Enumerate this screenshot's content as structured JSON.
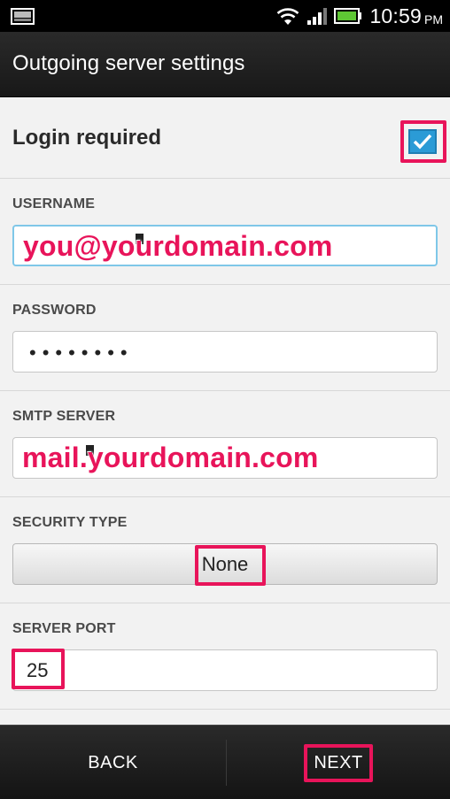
{
  "status_bar": {
    "time": "10:59",
    "ampm": "PM",
    "icons": [
      "notification-image-icon",
      "wifi-icon",
      "signal-icon",
      "battery-icon"
    ]
  },
  "header": {
    "title": "Outgoing server settings"
  },
  "login": {
    "label": "Login required",
    "checked": true
  },
  "fields": {
    "username": {
      "label": "USERNAME",
      "value": "you@yourdomain.com"
    },
    "password": {
      "label": "PASSWORD",
      "value": "••••••••"
    },
    "smtp_server": {
      "label": "SMTP SERVER",
      "value": "mail.yourdomain.com"
    },
    "security_type": {
      "label": "SECURITY TYPE",
      "value": "None"
    },
    "server_port": {
      "label": "SERVER PORT",
      "value": "25"
    }
  },
  "footer": {
    "back_label": "BACK",
    "next_label": "NEXT"
  },
  "colors": {
    "highlight": "#e8145a",
    "checkbox": "#2b9bd6",
    "focus_border": "#7fc7e8"
  }
}
